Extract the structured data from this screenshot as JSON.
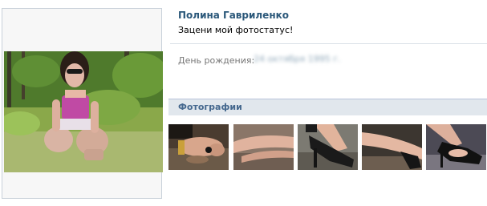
{
  "profile": {
    "name": "Полина Гавриленко",
    "status": "Зацени мой фотостатус!",
    "avatar_icon": "profile-photo"
  },
  "info": {
    "birthday_label": "День рождения:",
    "birthday_value": "24 октября 1995 г."
  },
  "photos": {
    "section_title": "Фотографии",
    "thumbnails": [
      {
        "icon": "photo-hand-ring"
      },
      {
        "icon": "photo-legs"
      },
      {
        "icon": "photo-high-heels"
      },
      {
        "icon": "photo-leg"
      },
      {
        "icon": "photo-black-shoe"
      }
    ]
  },
  "colors": {
    "name_link": "#2b587a",
    "section_header_bg": "#e1e7ed",
    "section_header_text": "#45688e",
    "divider": "#dae1e8",
    "label_gray": "#777777"
  }
}
